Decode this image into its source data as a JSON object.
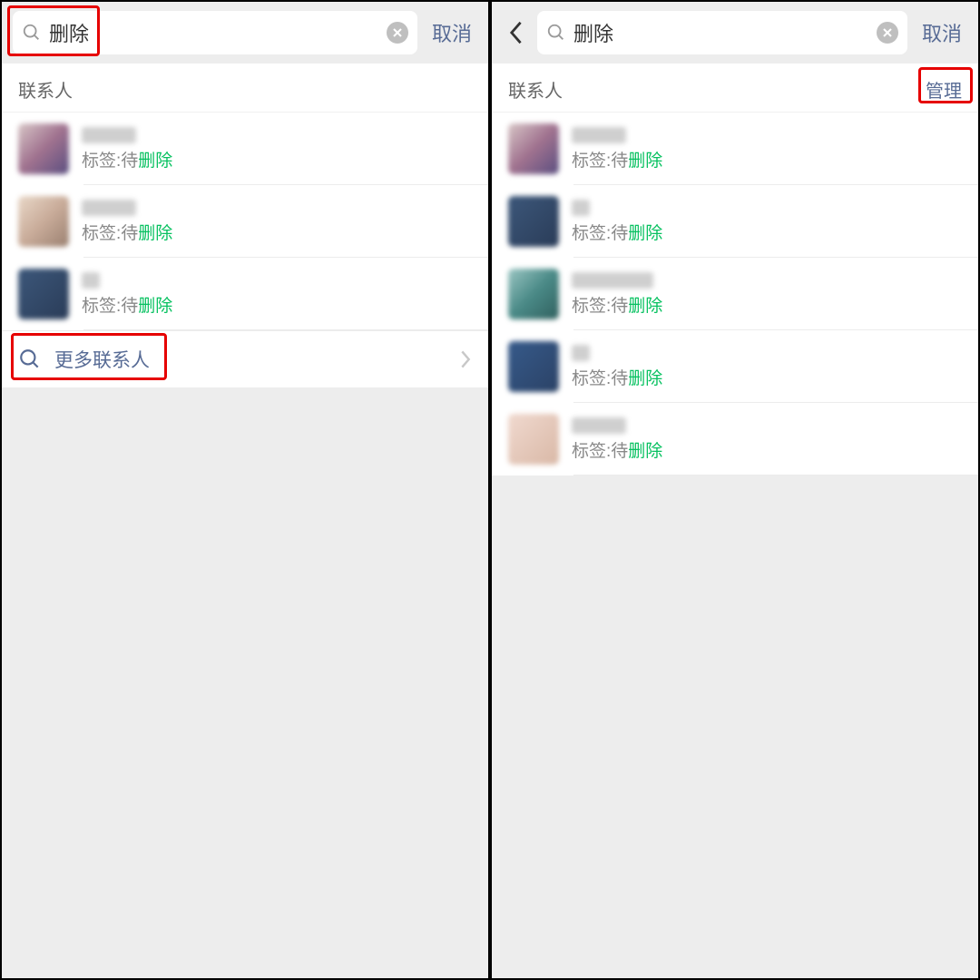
{
  "left": {
    "search": {
      "value": "删除"
    },
    "cancel": "取消",
    "section": "联系人",
    "contacts": [
      {
        "tag_prefix": "标签:待",
        "tag_hl": "删除"
      },
      {
        "tag_prefix": "标签:待",
        "tag_hl": "删除"
      },
      {
        "tag_prefix": "标签:待",
        "tag_hl": "删除"
      }
    ],
    "more": "更多联系人"
  },
  "right": {
    "search": {
      "value": "删除"
    },
    "cancel": "取消",
    "section": "联系人",
    "manage": "管理",
    "contacts": [
      {
        "tag_prefix": "标签:待",
        "tag_hl": "删除"
      },
      {
        "tag_prefix": "标签:待",
        "tag_hl": "删除"
      },
      {
        "tag_prefix": "标签:待",
        "tag_hl": "删除"
      },
      {
        "tag_prefix": "标签:待",
        "tag_hl": "删除"
      },
      {
        "tag_prefix": "标签:待",
        "tag_hl": "删除"
      }
    ]
  }
}
